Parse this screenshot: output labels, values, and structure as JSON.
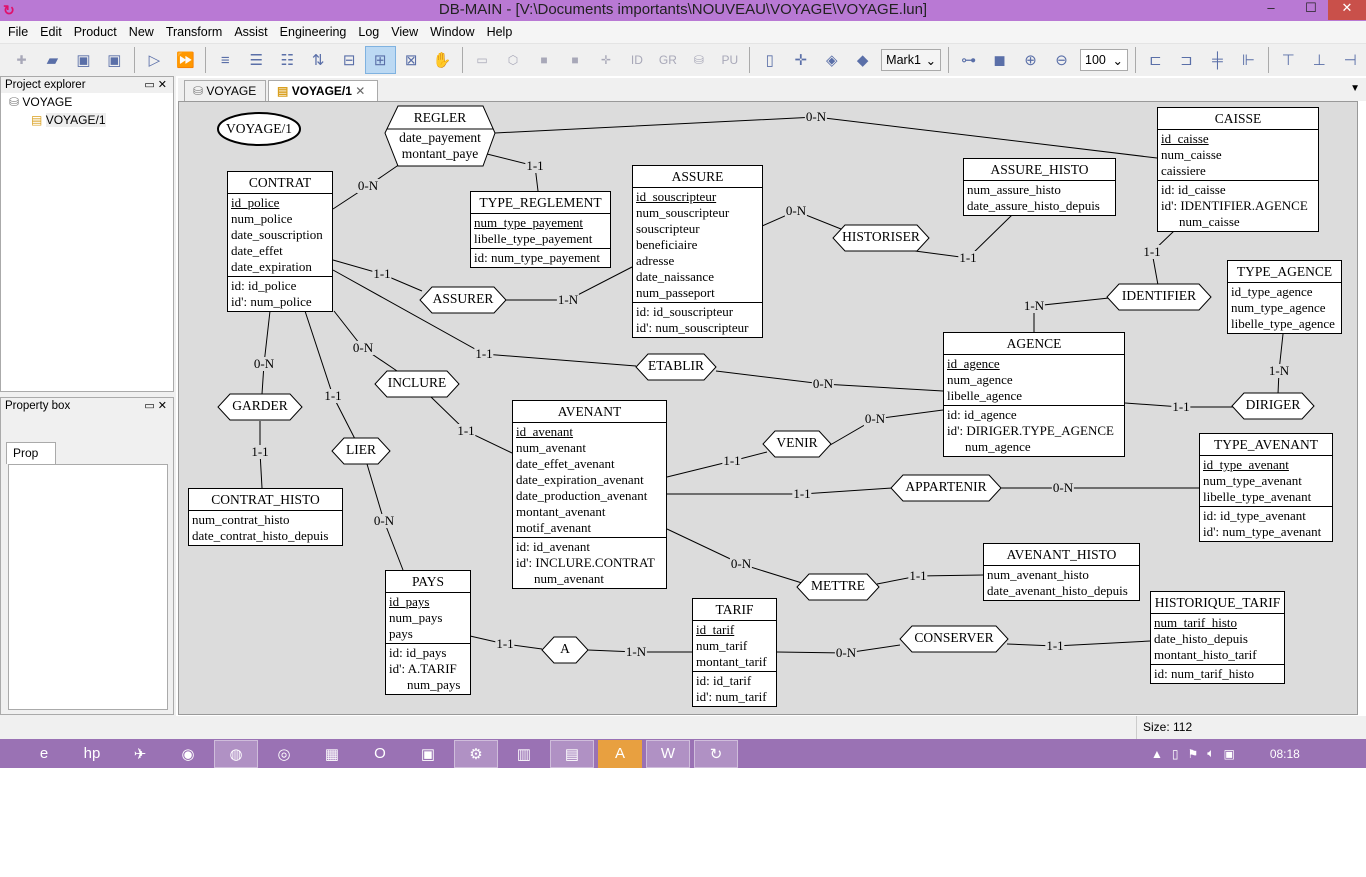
{
  "window": {
    "title": "DB-MAIN  - [V:\\Documents importants\\NOUVEAU\\VOYAGE\\VOYAGE.lun]",
    "minimize": "–",
    "maximize": "☐",
    "close": "✕"
  },
  "menu": [
    "File",
    "Edit",
    "Product",
    "New",
    "Transform",
    "Assist",
    "Engineering",
    "Log",
    "View",
    "Window",
    "Help"
  ],
  "toolbar": {
    "icons": [
      "new-project-icon",
      "open-icon",
      "save-icon",
      "save-as-icon",
      "|",
      "run-icon",
      "run-all-icon",
      "|",
      "text-compact-icon",
      "text-standard-icon",
      "text-extended-icon",
      "text-sorted-icon",
      "graph-compact-icon",
      "graph-standard-icon",
      "graph-dependency-icon",
      "hand-icon",
      "|",
      "new-entity-icon",
      "new-rel-icon",
      "new-attr-icon",
      "new-group-icon",
      "new-role-icon",
      "ID",
      "GR",
      "new-collection-icon",
      "PU",
      "|",
      "note-icon",
      "link-note-icon",
      "paint-icon",
      "tag-icon"
    ],
    "mark_select": "Mark1",
    "zoom_select": "100",
    "icons2": [
      "link-icon",
      "camera-icon",
      "zoom-in-icon",
      "zoom-out-icon"
    ],
    "icons3": [
      "align-left-icon",
      "align-right-icon",
      "align-center-icon",
      "align-distribute-icon",
      "|",
      "align-top-icon",
      "align-bottom-icon",
      "align-middle-icon"
    ]
  },
  "explorer": {
    "title": "Project explorer",
    "items": [
      "VOYAGE",
      "VOYAGE/1"
    ]
  },
  "property_box": {
    "title": "Property box",
    "tab": "Prop"
  },
  "tabs": [
    {
      "label": "VOYAGE"
    },
    {
      "label": "VOYAGE/1",
      "active": true
    }
  ],
  "diagram": {
    "schema_label": "VOYAGE/1",
    "entities": [
      {
        "name": "CONTRAT",
        "primary": "id_police",
        "attrs": [
          "id_police",
          "num_police",
          "date_souscription",
          "date_effet",
          "date_expiration"
        ],
        "ids": [
          "id: id_police",
          "id': num_police"
        ]
      },
      {
        "name": "TYPE_REGLEMENT",
        "primary": "num_type_payement",
        "attrs": [
          "num_type_payement",
          "libelle_type_payement"
        ],
        "ids": [
          "id: num_type_payement"
        ]
      },
      {
        "name": "ASSURE",
        "primary": "id_souscripteur",
        "attrs": [
          "id_souscripteur",
          "num_souscripteur",
          "souscripteur",
          "beneficiaire",
          "adresse",
          "date_naissance",
          "num_passeport"
        ],
        "ids": [
          "id: id_souscripteur",
          "id': num_souscripteur"
        ]
      },
      {
        "name": "ASSURE_HISTO",
        "attrs": [
          "num_assure_histo",
          "date_assure_histo_depuis"
        ],
        "ids": []
      },
      {
        "name": "CAISSE",
        "primary": "id_caisse",
        "attrs": [
          "id_caisse",
          "num_caisse",
          "caissiere"
        ],
        "ids": [
          "id: id_caisse",
          [
            "id': IDENTIFIER.AGENCE",
            "num_caisse"
          ]
        ]
      },
      {
        "name": "TYPE_AGENCE",
        "attrs": [
          "id_type_agence",
          "num_type_agence",
          "libelle_type_agence"
        ],
        "ids": []
      },
      {
        "name": "AGENCE",
        "primary": "id_agence",
        "attrs": [
          "id_agence",
          "num_agence",
          "libelle_agence"
        ],
        "ids": [
          "id: id_agence",
          [
            "id': DIRIGER.TYPE_AGENCE",
            "num_agence"
          ]
        ]
      },
      {
        "name": "TYPE_AVENANT",
        "primary": "id_type_avenant",
        "attrs": [
          "id_type_avenant",
          "num_type_avenant",
          "libelle_type_avenant"
        ],
        "ids": [
          "id: id_type_avenant",
          "id': num_type_avenant"
        ]
      },
      {
        "name": "AVENANT",
        "primary": "id_avenant",
        "attrs": [
          "id_avenant",
          "num_avenant",
          "date_effet_avenant",
          "date_expiration_avenant",
          "date_production_avenant",
          "montant_avenant",
          "motif_avenant"
        ],
        "ids": [
          "id: id_avenant",
          [
            "id': INCLURE.CONTRAT",
            "num_avenant"
          ]
        ]
      },
      {
        "name": "CONTRAT_HISTO",
        "attrs": [
          "num_contrat_histo",
          "date_contrat_histo_depuis"
        ],
        "ids": []
      },
      {
        "name": "PAYS",
        "primary": "id_pays",
        "attrs": [
          "id_pays",
          "num_pays",
          "pays"
        ],
        "ids": [
          "id: id_pays",
          [
            "id': A.TARIF",
            "num_pays"
          ]
        ]
      },
      {
        "name": "TARIF",
        "primary": "id_tarif",
        "attrs": [
          "id_tarif",
          "num_tarif",
          "montant_tarif"
        ],
        "ids": [
          "id: id_tarif",
          "id': num_tarif"
        ]
      },
      {
        "name": "AVENANT_HISTO",
        "attrs": [
          "num_avenant_histo",
          "date_avenant_histo_depuis"
        ],
        "ids": []
      },
      {
        "name": "HISTORIQUE_TARIF",
        "primary": "num_tarif_histo",
        "attrs": [
          "num_tarif_histo",
          "date_histo_depuis",
          "montant_histo_tarif"
        ],
        "ids": [
          "id: num_tarif_histo"
        ]
      }
    ],
    "relations": [
      {
        "name": "REGLER",
        "attrs": [
          "date_payement",
          "montant_paye"
        ]
      },
      {
        "name": "ASSURER"
      },
      {
        "name": "HISTORISER"
      },
      {
        "name": "IDENTIFIER"
      },
      {
        "name": "ETABLIR"
      },
      {
        "name": "INCLURE"
      },
      {
        "name": "GARDER"
      },
      {
        "name": "LIER"
      },
      {
        "name": "VENIR"
      },
      {
        "name": "APPARTENIR"
      },
      {
        "name": "DIRIGER"
      },
      {
        "name": "METTRE"
      },
      {
        "name": "A"
      },
      {
        "name": "CONSERVER"
      }
    ],
    "links": [
      {
        "rel": "REGLER",
        "ent": "CAISSE",
        "card": "0-N"
      },
      {
        "rel": "REGLER",
        "ent": "CONTRAT",
        "card": "0-N"
      },
      {
        "rel": "REGLER",
        "ent": "TYPE_REGLEMENT",
        "card": "1-1"
      },
      {
        "rel": "ASSURER",
        "ent": "CONTRAT",
        "card": "1-1"
      },
      {
        "rel": "ASSURER",
        "ent": "ASSURE",
        "card": "1-N"
      },
      {
        "rel": "HISTORISER",
        "ent": "ASSURE",
        "card": "0-N"
      },
      {
        "rel": "HISTORISER",
        "ent": "ASSURE_HISTO",
        "card": "1-1"
      },
      {
        "rel": "IDENTIFIER",
        "ent": "CAISSE",
        "card": "1-1"
      },
      {
        "rel": "IDENTIFIER",
        "ent": "AGENCE",
        "card": "1-N"
      },
      {
        "rel": "DIRIGER",
        "ent": "TYPE_AGENCE",
        "card": "1-N"
      },
      {
        "rel": "DIRIGER",
        "ent": "AGENCE",
        "card": "1-1"
      },
      {
        "rel": "ETABLIR",
        "ent": "CONTRAT",
        "card": "1-1"
      },
      {
        "rel": "ETABLIR",
        "ent": "AGENCE",
        "card": "0-N"
      },
      {
        "rel": "INCLURE",
        "ent": "CONTRAT",
        "card": "0-N"
      },
      {
        "rel": "INCLURE",
        "ent": "AVENANT",
        "card": "1-1"
      },
      {
        "rel": "GARDER",
        "ent": "CONTRAT",
        "card": "0-N"
      },
      {
        "rel": "GARDER",
        "ent": "CONTRAT_HISTO",
        "card": "1-1"
      },
      {
        "rel": "LIER",
        "ent": "CONTRAT",
        "card": "1-1"
      },
      {
        "rel": "LIER",
        "ent": "PAYS",
        "card": "0-N"
      },
      {
        "rel": "VENIR",
        "ent": "AVENANT",
        "card": "1-1"
      },
      {
        "rel": "VENIR",
        "ent": "AGENCE",
        "card": "0-N"
      },
      {
        "rel": "APPARTENIR",
        "ent": "AVENANT",
        "card": "1-1"
      },
      {
        "rel": "APPARTENIR",
        "ent": "TYPE_AVENANT",
        "card": "0-N"
      },
      {
        "rel": "METTRE",
        "ent": "AVENANT",
        "card": "0-N"
      },
      {
        "rel": "METTRE",
        "ent": "AVENANT_HISTO",
        "card": "1-1"
      },
      {
        "rel": "A",
        "ent": "PAYS",
        "card": "1-1"
      },
      {
        "rel": "A",
        "ent": "TARIF",
        "card": "1-N"
      },
      {
        "rel": "CONSERVER",
        "ent": "TARIF",
        "card": "0-N"
      },
      {
        "rel": "CONSERVER",
        "ent": "HISTORIQUE_TARIF",
        "card": "1-1"
      }
    ]
  },
  "status": {
    "size": "Size: 112"
  },
  "taskbar": {
    "apps": [
      {
        "icon": "internet-explorer-icon",
        "glyph": "e"
      },
      {
        "icon": "hp-icon",
        "glyph": "hp"
      },
      {
        "icon": "app-blue-icon",
        "glyph": "✈"
      },
      {
        "icon": "media-icon",
        "glyph": "◉"
      },
      {
        "icon": "firefox-icon",
        "glyph": "◍",
        "state": "open"
      },
      {
        "icon": "chrome-icon",
        "glyph": "◎"
      },
      {
        "icon": "app-colorful-icon",
        "glyph": "▦"
      },
      {
        "icon": "opera-icon",
        "glyph": "O"
      },
      {
        "icon": "app-orange-icon",
        "glyph": "▣"
      },
      {
        "icon": "app-gears-icon",
        "glyph": "⚙",
        "state": "open"
      },
      {
        "icon": "app-bars-icon",
        "glyph": "▥"
      },
      {
        "icon": "file-explorer-icon",
        "glyph": "▤",
        "state": "open"
      },
      {
        "icon": "acrobat-icon",
        "glyph": "A",
        "state": "active"
      },
      {
        "icon": "word-icon",
        "glyph": "W",
        "state": "open"
      },
      {
        "icon": "db-main-icon",
        "glyph": "↻",
        "state": "open"
      }
    ],
    "clock": "08:18"
  }
}
